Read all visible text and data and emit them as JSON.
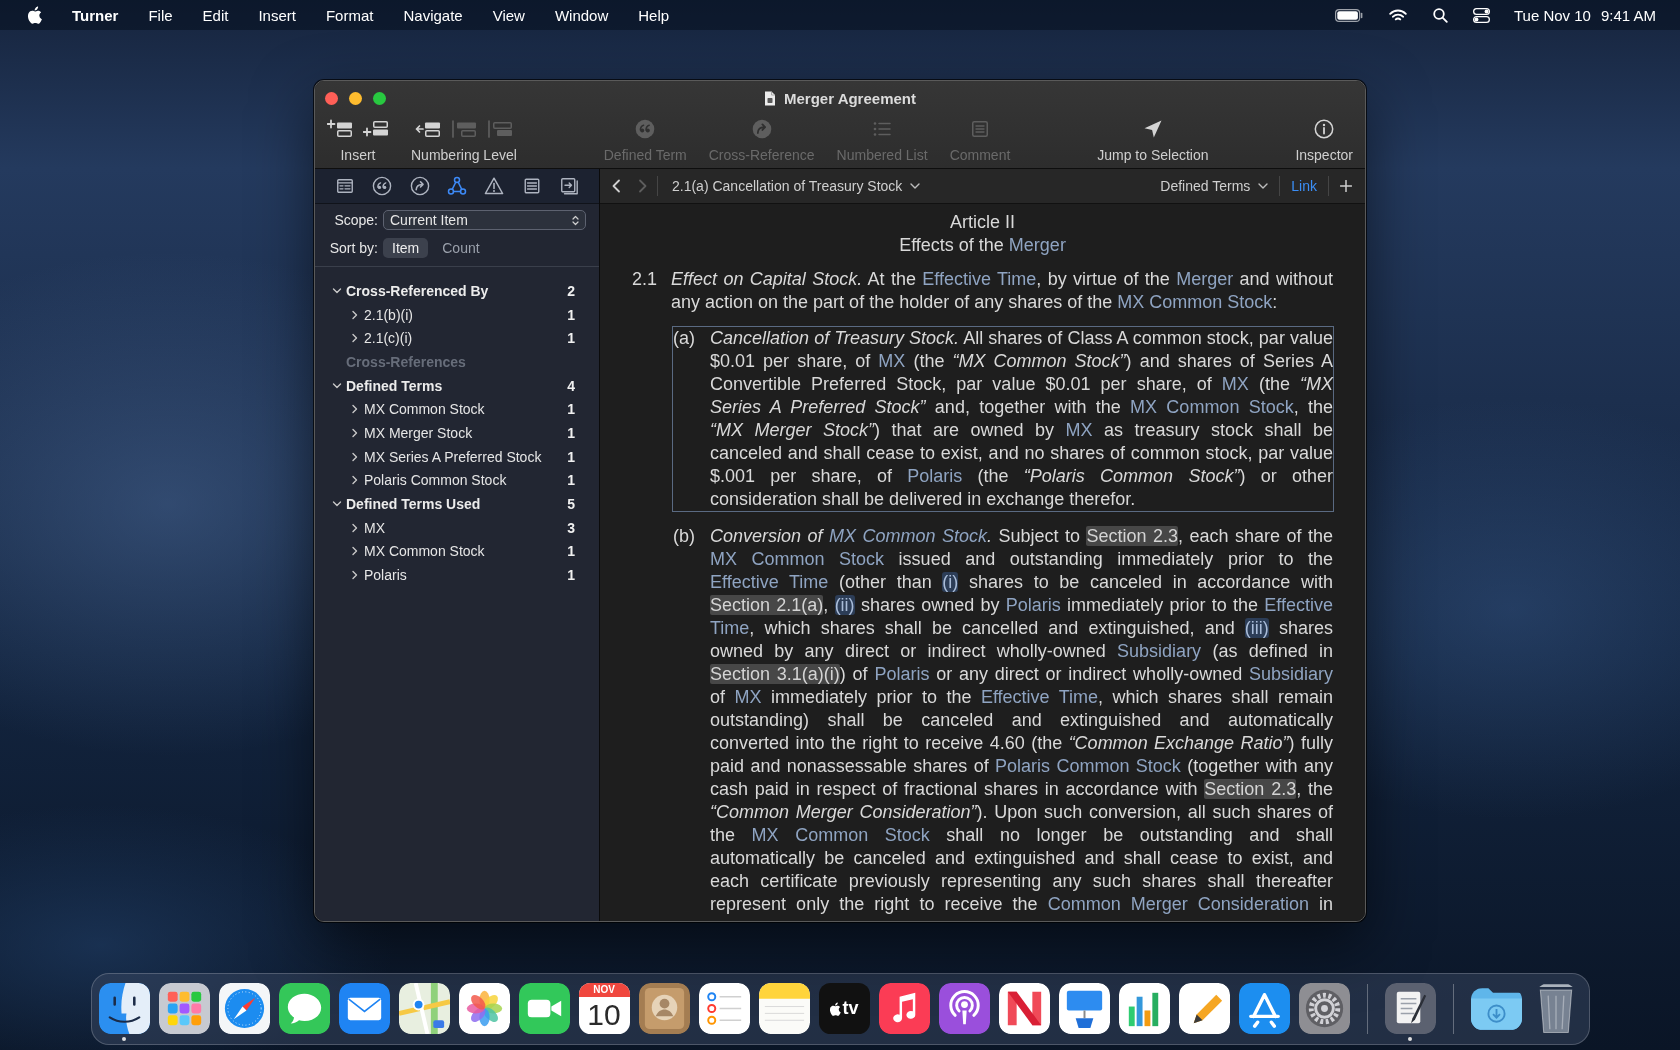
{
  "menu_bar": {
    "app": "Turner",
    "menus": [
      "File",
      "Edit",
      "Insert",
      "Format",
      "Navigate",
      "View",
      "Window",
      "Help"
    ],
    "date": "Tue Nov 10",
    "time": "9:41 AM"
  },
  "window": {
    "title": "Merger Agreement"
  },
  "toolbar": {
    "groups": [
      {
        "items": [
          {
            "kind": "button_group",
            "label": "Insert",
            "buttons": [
              {
                "disabled": false
              },
              {
                "disabled": false
              }
            ]
          },
          {
            "kind": "button_group",
            "label": "Numbering Level",
            "buttons": [
              {
                "disabled": false
              },
              {
                "disabled": true
              },
              {
                "disabled": true
              }
            ]
          }
        ]
      },
      {
        "items": [
          {
            "kind": "button",
            "label": "Defined Term",
            "disabled": true
          },
          {
            "kind": "button",
            "label": "Cross-Reference",
            "disabled": true
          },
          {
            "kind": "button",
            "label": "Numbered List",
            "disabled": true
          },
          {
            "kind": "button",
            "label": "Comment",
            "disabled": true
          }
        ]
      },
      {
        "items": [
          {
            "kind": "button",
            "label": "Jump to Selection",
            "disabled": false
          }
        ]
      },
      {
        "items": [
          {
            "kind": "button",
            "label": "Inspector",
            "disabled": false
          }
        ]
      }
    ]
  },
  "sidebar": {
    "tabs": [
      {
        "selected": false
      },
      {
        "selected": false
      },
      {
        "selected": false
      },
      {
        "selected": true
      },
      {
        "selected": false
      },
      {
        "selected": false
      },
      {
        "selected": false
      }
    ],
    "scope": {
      "label": "Scope:",
      "value": "Current Item"
    },
    "sort": {
      "label": "Sort by:",
      "options": [
        {
          "label": "Item",
          "selected": true
        },
        {
          "label": "Count",
          "selected": false
        }
      ]
    },
    "groups": [
      {
        "label": "Cross-Referenced By",
        "count": "2",
        "expanded": true,
        "disabled": false,
        "children": [
          {
            "label": "2.1(b)(i)",
            "count": "1",
            "expanded": false
          },
          {
            "label": "2.1(c)(i)",
            "count": "1",
            "expanded": false
          }
        ]
      },
      {
        "label": "Cross-References",
        "disabled": true
      },
      {
        "label": "Defined Terms",
        "count": "4",
        "expanded": true,
        "disabled": false,
        "children": [
          {
            "label": "MX Common Stock",
            "count": "1",
            "expanded": false
          },
          {
            "label": "MX Merger Stock",
            "count": "1",
            "expanded": false
          },
          {
            "label": "MX Series A Preferred Stock",
            "count": "1",
            "expanded": false
          },
          {
            "label": "Polaris Common Stock",
            "count": "1",
            "expanded": false
          }
        ]
      },
      {
        "label": "Defined Terms Used",
        "count": "5",
        "expanded": true,
        "disabled": false,
        "children": [
          {
            "label": "MX",
            "count": "3",
            "expanded": false
          },
          {
            "label": "MX Common Stock",
            "count": "1",
            "expanded": false
          },
          {
            "label": "Polaris",
            "count": "1",
            "expanded": false
          }
        ]
      }
    ]
  },
  "navigation": {
    "back": {
      "disabled": false
    },
    "forward": {
      "disabled": true
    },
    "breadcrumb": "2.1(a) Cancellation of Treasury Stock",
    "view_menu": "Defined Terms",
    "link": "Link"
  },
  "document": {
    "title": "Article II",
    "subtitle": [
      {
        "kind": "plain",
        "text": "Effects of the "
      },
      {
        "kind": "term",
        "text": "Merger"
      }
    ],
    "sections": [
      {
        "number": "2.1",
        "lines": [
          [
            {
              "kind": "italic",
              "text": "Effect on Capital Stock."
            },
            {
              "kind": "plain",
              "text": " At the "
            },
            {
              "kind": "term",
              "text": "Effective Time"
            },
            {
              "kind": "plain",
              "text": ", by virtue of the "
            },
            {
              "kind": "term",
              "text": "Merger"
            },
            {
              "kind": "plain",
              "text": " and without"
            }
          ],
          [
            {
              "kind": "plain",
              "text": "any action on the part of the holder of any shares of the "
            },
            {
              "kind": "term",
              "text": "MX Common Stock"
            },
            {
              "kind": "plain",
              "text": ":"
            }
          ]
        ],
        "clauses": [
          {
            "label": "(a)",
            "selected": true,
            "continues_below": false,
            "lines": [
              [
                {
                  "kind": "italic",
                  "text": "Cancellation of Treasury Stock."
                },
                {
                  "kind": "plain",
                  "text": " All shares of Class A common stock, par value"
                }
              ],
              [
                {
                  "kind": "plain",
                  "text": "$0.01 per share, of "
                },
                {
                  "kind": "term",
                  "text": "MX"
                },
                {
                  "kind": "plain",
                  "text": " (the "
                },
                {
                  "kind": "italic",
                  "text": "“MX Common Stock”"
                },
                {
                  "kind": "plain",
                  "text": ") and shares of Series A"
                }
              ],
              [
                {
                  "kind": "plain",
                  "text": "Convertible Preferred Stock, par value $0.01 per share, of "
                },
                {
                  "kind": "term",
                  "text": "MX"
                },
                {
                  "kind": "plain",
                  "text": " (the "
                },
                {
                  "kind": "italic",
                  "text": "“MX"
                }
              ],
              [
                {
                  "kind": "italic",
                  "text": "Series A Preferred Stock”"
                },
                {
                  "kind": "plain",
                  "text": " and, together with the "
                },
                {
                  "kind": "term",
                  "text": "MX Common Stock"
                },
                {
                  "kind": "plain",
                  "text": ", the"
                }
              ],
              [
                {
                  "kind": "italic",
                  "text": "“MX Merger Stock”"
                },
                {
                  "kind": "plain",
                  "text": ") that are owned by "
                },
                {
                  "kind": "term",
                  "text": "MX"
                },
                {
                  "kind": "plain",
                  "text": " as treasury stock shall be"
                }
              ],
              [
                {
                  "kind": "plain",
                  "text": "canceled and shall cease to exist, and no shares of common stock, par value"
                }
              ],
              [
                {
                  "kind": "plain",
                  "text": "$.001 per share, of "
                },
                {
                  "kind": "term",
                  "text": "Polaris"
                },
                {
                  "kind": "plain",
                  "text": " (the "
                },
                {
                  "kind": "italic",
                  "text": "“Polaris Common Stock”"
                },
                {
                  "kind": "plain",
                  "text": ") or other"
                }
              ],
              [
                {
                  "kind": "plain",
                  "text": "consideration shall be delivered in exchange therefor."
                }
              ]
            ]
          },
          {
            "label": "(b)",
            "selected": false,
            "continues_below": true,
            "lines": [
              [
                {
                  "kind": "italic",
                  "text": "Conversion of "
                },
                {
                  "kind": "italic_term",
                  "text": "MX Common Stock"
                },
                {
                  "kind": "italic",
                  "text": "."
                },
                {
                  "kind": "plain",
                  "text": " Subject to "
                },
                {
                  "kind": "section_ref",
                  "text": "Section 2.3"
                },
                {
                  "kind": "plain",
                  "text": ", each share of the"
                }
              ],
              [
                {
                  "kind": "term",
                  "text": "MX Common Stock"
                },
                {
                  "kind": "plain",
                  "text": " issued and outstanding immediately prior to the"
                }
              ],
              [
                {
                  "kind": "term",
                  "text": "Effective Time"
                },
                {
                  "kind": "plain",
                  "text": " (other than "
                },
                {
                  "kind": "clause_ref",
                  "text": "(i)"
                },
                {
                  "kind": "plain",
                  "text": " shares to be canceled in accordance with"
                }
              ],
              [
                {
                  "kind": "section_ref",
                  "text": "Section 2.1(a)"
                },
                {
                  "kind": "plain",
                  "text": ", "
                },
                {
                  "kind": "clause_ref",
                  "text": "(ii)"
                },
                {
                  "kind": "plain",
                  "text": " shares owned by "
                },
                {
                  "kind": "term",
                  "text": "Polaris"
                },
                {
                  "kind": "plain",
                  "text": " immediately prior to the "
                },
                {
                  "kind": "term",
                  "text": "Effective"
                }
              ],
              [
                {
                  "kind": "term",
                  "text": "Time"
                },
                {
                  "kind": "plain",
                  "text": ", which shares shall be cancelled and extinguished, and "
                },
                {
                  "kind": "clause_ref",
                  "text": "(iii)"
                },
                {
                  "kind": "plain",
                  "text": " shares"
                }
              ],
              [
                {
                  "kind": "plain",
                  "text": "owned by any direct or indirect wholly-owned "
                },
                {
                  "kind": "term",
                  "text": "Subsidiary"
                },
                {
                  "kind": "plain",
                  "text": " (as defined in"
                }
              ],
              [
                {
                  "kind": "section_ref",
                  "text": "Section 3.1(a)(i)"
                },
                {
                  "kind": "plain",
                  "text": ") of "
                },
                {
                  "kind": "term",
                  "text": "Polaris"
                },
                {
                  "kind": "plain",
                  "text": " or any direct or indirect wholly-owned "
                },
                {
                  "kind": "term",
                  "text": "Subsidiary"
                }
              ],
              [
                {
                  "kind": "plain",
                  "text": "of "
                },
                {
                  "kind": "term",
                  "text": "MX"
                },
                {
                  "kind": "plain",
                  "text": " immediately prior to the "
                },
                {
                  "kind": "term",
                  "text": "Effective Time"
                },
                {
                  "kind": "plain",
                  "text": ", which shares shall remain"
                }
              ],
              [
                {
                  "kind": "plain",
                  "text": "outstanding) shall be canceled and extinguished and automatically"
                }
              ],
              [
                {
                  "kind": "plain",
                  "text": "converted into the right to receive 4.60 (the "
                },
                {
                  "kind": "italic",
                  "text": "“Common Exchange Ratio”"
                },
                {
                  "kind": "plain",
                  "text": ") fully"
                }
              ],
              [
                {
                  "kind": "plain",
                  "text": "paid and nonassessable shares of "
                },
                {
                  "kind": "term",
                  "text": "Polaris Common Stock"
                },
                {
                  "kind": "plain",
                  "text": " (together with any"
                }
              ],
              [
                {
                  "kind": "plain",
                  "text": "cash paid in respect of fractional shares in accordance with "
                },
                {
                  "kind": "section_ref",
                  "text": "Section 2.3"
                },
                {
                  "kind": "plain",
                  "text": ", the"
                }
              ],
              [
                {
                  "kind": "italic",
                  "text": "“Common Merger Consideration”"
                },
                {
                  "kind": "plain",
                  "text": "). Upon such conversion, all such shares of"
                }
              ],
              [
                {
                  "kind": "plain",
                  "text": "the "
                },
                {
                  "kind": "term",
                  "text": "MX Common Stock"
                },
                {
                  "kind": "plain",
                  "text": " shall no longer be outstanding and shall"
                }
              ],
              [
                {
                  "kind": "plain",
                  "text": "automatically be canceled and extinguished and shall cease to exist, and"
                }
              ],
              [
                {
                  "kind": "plain",
                  "text": "each certificate previously representing any such shares shall thereafter"
                }
              ],
              [
                {
                  "kind": "plain",
                  "text": "represent only the right to receive the "
                },
                {
                  "kind": "term",
                  "text": "Common Merger Consideration"
                },
                {
                  "kind": "plain",
                  "text": " in"
                }
              ]
            ]
          }
        ]
      }
    ]
  },
  "dock": {
    "sections": [
      {
        "items": [
          {
            "running": true
          },
          {
            "running": false
          },
          {
            "running": false
          },
          {
            "running": false
          },
          {
            "running": false
          },
          {
            "running": false
          },
          {
            "running": false
          },
          {
            "running": false
          },
          {
            "running": false,
            "month": "NOV",
            "day": "10"
          },
          {
            "running": false
          },
          {
            "running": false
          },
          {
            "running": false
          },
          {
            "running": false,
            "label": "tv"
          },
          {
            "running": false
          },
          {
            "running": false
          },
          {
            "running": false
          },
          {
            "running": false
          },
          {
            "running": false
          },
          {
            "running": false
          },
          {
            "running": false
          },
          {
            "running": false
          }
        ]
      },
      {
        "items": [
          {
            "running": true
          }
        ]
      },
      {
        "items": [
          {
            "running": false
          },
          {
            "running": false
          }
        ]
      }
    ]
  }
}
